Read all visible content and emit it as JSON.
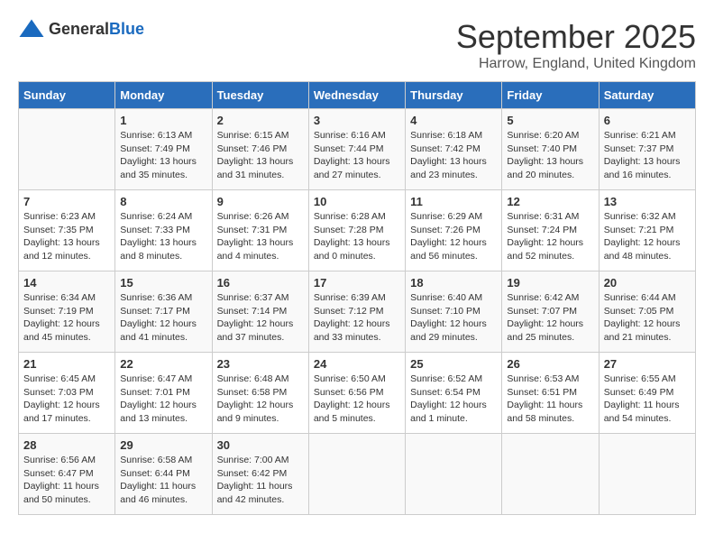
{
  "logo": {
    "general": "General",
    "blue": "Blue",
    "icon_color": "#1a6abf"
  },
  "title": "September 2025",
  "subtitle": "Harrow, England, United Kingdom",
  "headers": [
    "Sunday",
    "Monday",
    "Tuesday",
    "Wednesday",
    "Thursday",
    "Friday",
    "Saturday"
  ],
  "rows": [
    [
      {
        "day": "",
        "sunrise": "",
        "sunset": "",
        "daylight": ""
      },
      {
        "day": "1",
        "sunrise": "Sunrise: 6:13 AM",
        "sunset": "Sunset: 7:49 PM",
        "daylight": "Daylight: 13 hours and 35 minutes."
      },
      {
        "day": "2",
        "sunrise": "Sunrise: 6:15 AM",
        "sunset": "Sunset: 7:46 PM",
        "daylight": "Daylight: 13 hours and 31 minutes."
      },
      {
        "day": "3",
        "sunrise": "Sunrise: 6:16 AM",
        "sunset": "Sunset: 7:44 PM",
        "daylight": "Daylight: 13 hours and 27 minutes."
      },
      {
        "day": "4",
        "sunrise": "Sunrise: 6:18 AM",
        "sunset": "Sunset: 7:42 PM",
        "daylight": "Daylight: 13 hours and 23 minutes."
      },
      {
        "day": "5",
        "sunrise": "Sunrise: 6:20 AM",
        "sunset": "Sunset: 7:40 PM",
        "daylight": "Daylight: 13 hours and 20 minutes."
      },
      {
        "day": "6",
        "sunrise": "Sunrise: 6:21 AM",
        "sunset": "Sunset: 7:37 PM",
        "daylight": "Daylight: 13 hours and 16 minutes."
      }
    ],
    [
      {
        "day": "7",
        "sunrise": "Sunrise: 6:23 AM",
        "sunset": "Sunset: 7:35 PM",
        "daylight": "Daylight: 13 hours and 12 minutes."
      },
      {
        "day": "8",
        "sunrise": "Sunrise: 6:24 AM",
        "sunset": "Sunset: 7:33 PM",
        "daylight": "Daylight: 13 hours and 8 minutes."
      },
      {
        "day": "9",
        "sunrise": "Sunrise: 6:26 AM",
        "sunset": "Sunset: 7:31 PM",
        "daylight": "Daylight: 13 hours and 4 minutes."
      },
      {
        "day": "10",
        "sunrise": "Sunrise: 6:28 AM",
        "sunset": "Sunset: 7:28 PM",
        "daylight": "Daylight: 13 hours and 0 minutes."
      },
      {
        "day": "11",
        "sunrise": "Sunrise: 6:29 AM",
        "sunset": "Sunset: 7:26 PM",
        "daylight": "Daylight: 12 hours and 56 minutes."
      },
      {
        "day": "12",
        "sunrise": "Sunrise: 6:31 AM",
        "sunset": "Sunset: 7:24 PM",
        "daylight": "Daylight: 12 hours and 52 minutes."
      },
      {
        "day": "13",
        "sunrise": "Sunrise: 6:32 AM",
        "sunset": "Sunset: 7:21 PM",
        "daylight": "Daylight: 12 hours and 48 minutes."
      }
    ],
    [
      {
        "day": "14",
        "sunrise": "Sunrise: 6:34 AM",
        "sunset": "Sunset: 7:19 PM",
        "daylight": "Daylight: 12 hours and 45 minutes."
      },
      {
        "day": "15",
        "sunrise": "Sunrise: 6:36 AM",
        "sunset": "Sunset: 7:17 PM",
        "daylight": "Daylight: 12 hours and 41 minutes."
      },
      {
        "day": "16",
        "sunrise": "Sunrise: 6:37 AM",
        "sunset": "Sunset: 7:14 PM",
        "daylight": "Daylight: 12 hours and 37 minutes."
      },
      {
        "day": "17",
        "sunrise": "Sunrise: 6:39 AM",
        "sunset": "Sunset: 7:12 PM",
        "daylight": "Daylight: 12 hours and 33 minutes."
      },
      {
        "day": "18",
        "sunrise": "Sunrise: 6:40 AM",
        "sunset": "Sunset: 7:10 PM",
        "daylight": "Daylight: 12 hours and 29 minutes."
      },
      {
        "day": "19",
        "sunrise": "Sunrise: 6:42 AM",
        "sunset": "Sunset: 7:07 PM",
        "daylight": "Daylight: 12 hours and 25 minutes."
      },
      {
        "day": "20",
        "sunrise": "Sunrise: 6:44 AM",
        "sunset": "Sunset: 7:05 PM",
        "daylight": "Daylight: 12 hours and 21 minutes."
      }
    ],
    [
      {
        "day": "21",
        "sunrise": "Sunrise: 6:45 AM",
        "sunset": "Sunset: 7:03 PM",
        "daylight": "Daylight: 12 hours and 17 minutes."
      },
      {
        "day": "22",
        "sunrise": "Sunrise: 6:47 AM",
        "sunset": "Sunset: 7:01 PM",
        "daylight": "Daylight: 12 hours and 13 minutes."
      },
      {
        "day": "23",
        "sunrise": "Sunrise: 6:48 AM",
        "sunset": "Sunset: 6:58 PM",
        "daylight": "Daylight: 12 hours and 9 minutes."
      },
      {
        "day": "24",
        "sunrise": "Sunrise: 6:50 AM",
        "sunset": "Sunset: 6:56 PM",
        "daylight": "Daylight: 12 hours and 5 minutes."
      },
      {
        "day": "25",
        "sunrise": "Sunrise: 6:52 AM",
        "sunset": "Sunset: 6:54 PM",
        "daylight": "Daylight: 12 hours and 1 minute."
      },
      {
        "day": "26",
        "sunrise": "Sunrise: 6:53 AM",
        "sunset": "Sunset: 6:51 PM",
        "daylight": "Daylight: 11 hours and 58 minutes."
      },
      {
        "day": "27",
        "sunrise": "Sunrise: 6:55 AM",
        "sunset": "Sunset: 6:49 PM",
        "daylight": "Daylight: 11 hours and 54 minutes."
      }
    ],
    [
      {
        "day": "28",
        "sunrise": "Sunrise: 6:56 AM",
        "sunset": "Sunset: 6:47 PM",
        "daylight": "Daylight: 11 hours and 50 minutes."
      },
      {
        "day": "29",
        "sunrise": "Sunrise: 6:58 AM",
        "sunset": "Sunset: 6:44 PM",
        "daylight": "Daylight: 11 hours and 46 minutes."
      },
      {
        "day": "30",
        "sunrise": "Sunrise: 7:00 AM",
        "sunset": "Sunset: 6:42 PM",
        "daylight": "Daylight: 11 hours and 42 minutes."
      },
      {
        "day": "",
        "sunrise": "",
        "sunset": "",
        "daylight": ""
      },
      {
        "day": "",
        "sunrise": "",
        "sunset": "",
        "daylight": ""
      },
      {
        "day": "",
        "sunrise": "",
        "sunset": "",
        "daylight": ""
      },
      {
        "day": "",
        "sunrise": "",
        "sunset": "",
        "daylight": ""
      }
    ]
  ]
}
